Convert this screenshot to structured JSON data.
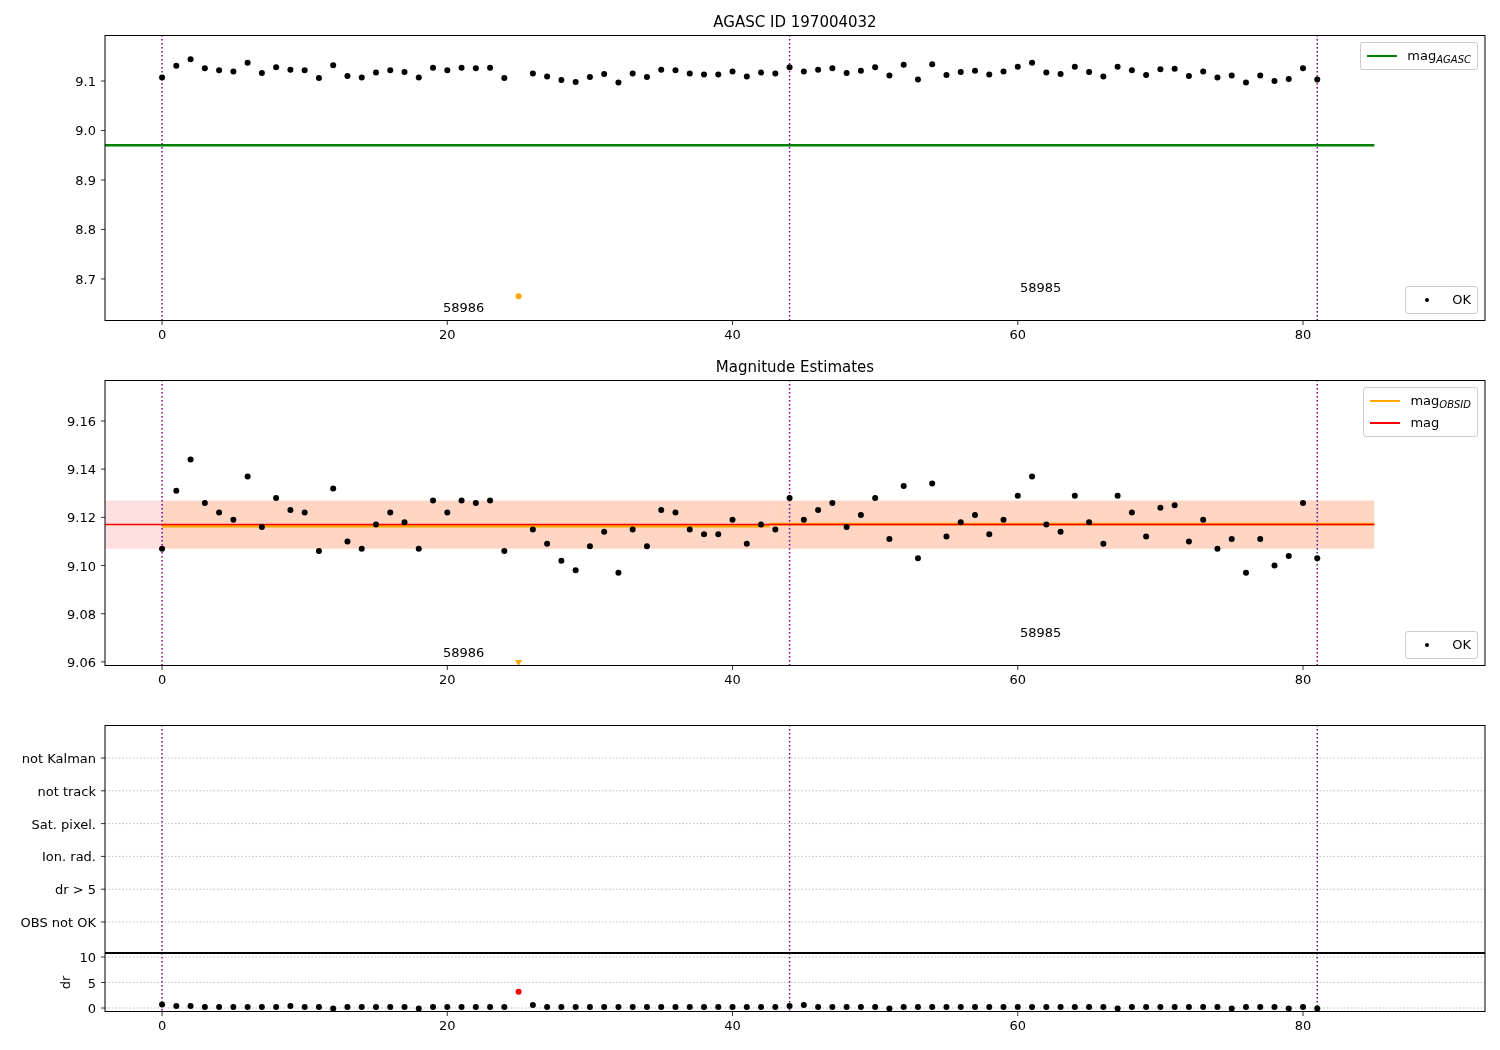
{
  "figure": {
    "panels": [
      {
        "kind": "chart",
        "chart_data": {
          "type": "scatter",
          "title": "AGASC ID 197004032",
          "legend": "right",
          "xlim": [
            -4,
            92.76
          ],
          "ylim": [
            8.615,
            9.193
          ],
          "xticks": [
            0,
            20,
            40,
            60,
            80
          ],
          "yticks": [
            {
              "value": 8.7,
              "label": "8.7"
            },
            {
              "value": 8.8,
              "label": "8.8"
            },
            {
              "value": 8.9,
              "label": "8.9"
            },
            {
              "value": 9.0,
              "label": "9.0"
            },
            {
              "value": 9.1,
              "label": "9.1"
            }
          ],
          "x": [
            0,
            1,
            2,
            3,
            4,
            5,
            6,
            7,
            8,
            9,
            10,
            11,
            12,
            13,
            14,
            15,
            16,
            17,
            18,
            19,
            20,
            21,
            22,
            23,
            24,
            25,
            26,
            27,
            28,
            29,
            30,
            31,
            32,
            33,
            34,
            35,
            36,
            37,
            38,
            39,
            40,
            41,
            42,
            43,
            44,
            45,
            46,
            47,
            48,
            49,
            50,
            51,
            52,
            53,
            54,
            55,
            56,
            57,
            58,
            59,
            60,
            61,
            62,
            63,
            64,
            65,
            66,
            67,
            68,
            69,
            70,
            71,
            72,
            73,
            74,
            75,
            76,
            77,
            78,
            79,
            80,
            81
          ],
          "series": [
            {
              "name": "mag$_{AGASC}$",
              "color": "#008000",
              "type": "line",
              "x": [
                -4,
                85
              ],
              "values": [
                8.97,
                8.97
              ]
            },
            {
              "name": "OK",
              "color": "#000000",
              "type": "scatter",
              "values": [
                9.107,
                9.131,
                9.144,
                9.126,
                9.122,
                9.119,
                9.137,
                9.116,
                9.128,
                9.123,
                9.122,
                9.106,
                9.132,
                9.11,
                9.107,
                9.117,
                9.122,
                9.118,
                9.107,
                9.127,
                9.122,
                9.127,
                9.126,
                9.127,
                9.106,
                null,
                9.115,
                9.109,
                9.102,
                9.098,
                9.108,
                9.114,
                9.097,
                9.115,
                9.108,
                9.123,
                9.122,
                9.115,
                9.113,
                9.113,
                9.119,
                9.109,
                9.117,
                9.115,
                9.128,
                9.119,
                9.123,
                9.126,
                9.116,
                9.121,
                9.128,
                9.111,
                9.133,
                9.103,
                9.134,
                9.112,
                9.118,
                9.121,
                9.113,
                9.119,
                9.129,
                9.137,
                9.117,
                9.114,
                9.129,
                9.118,
                9.109,
                9.129,
                9.122,
                9.112,
                9.124,
                9.125,
                9.11,
                9.119,
                9.107,
                9.111,
                9.097,
                9.111,
                9.1,
                9.104,
                9.126,
                9.103
              ]
            },
            {
              "color": "#ffa500",
              "type": "scatter",
              "values": [
                null,
                null,
                null,
                null,
                null,
                null,
                null,
                null,
                null,
                null,
                null,
                null,
                null,
                null,
                null,
                null,
                null,
                null,
                null,
                null,
                null,
                null,
                null,
                null,
                null,
                8.665,
                null,
                null,
                null,
                null,
                null,
                null,
                null,
                null,
                null,
                null,
                null,
                null,
                null,
                null,
                null,
                null,
                null,
                null,
                null,
                null,
                null,
                null,
                null,
                null,
                null,
                null,
                null,
                null,
                null,
                null,
                null,
                null,
                null,
                null,
                null,
                null,
                null,
                null,
                null,
                null,
                null,
                null,
                null,
                null,
                null,
                null,
                null,
                null,
                null,
                null,
                null,
                null,
                null,
                null,
                null,
                null
              ]
            }
          ],
          "ref_lines": [
            {
              "axis": "x",
              "value": 0,
              "color": "#800080"
            },
            {
              "axis": "x",
              "value": 44,
              "color": "#800080"
            },
            {
              "axis": "x",
              "value": 81,
              "color": "#800080"
            }
          ],
          "annotations": [
            "58986",
            "58985"
          ]
        }
      },
      {
        "kind": "chart",
        "chart_data": {
          "type": "scatter",
          "title": "Magnitude Estimates",
          "legend": "right",
          "xlim": [
            -4,
            92.76
          ],
          "ylim": [
            9.0583,
            9.177
          ],
          "xticks": [
            0,
            20,
            40,
            60,
            80
          ],
          "yticks": [
            {
              "value": 9.06,
              "label": "9.06"
            },
            {
              "value": 9.08,
              "label": "9.08"
            },
            {
              "value": 9.1,
              "label": "9.10"
            },
            {
              "value": 9.12,
              "label": "9.12"
            },
            {
              "value": 9.14,
              "label": "9.14"
            },
            {
              "value": 9.16,
              "label": "9.16"
            }
          ],
          "x": [
            0,
            1,
            2,
            3,
            4,
            5,
            6,
            7,
            8,
            9,
            10,
            11,
            12,
            13,
            14,
            15,
            16,
            17,
            18,
            19,
            20,
            21,
            22,
            23,
            24,
            25,
            26,
            27,
            28,
            29,
            30,
            31,
            32,
            33,
            34,
            35,
            36,
            37,
            38,
            39,
            40,
            41,
            42,
            43,
            44,
            45,
            46,
            47,
            48,
            49,
            50,
            51,
            52,
            53,
            54,
            55,
            56,
            57,
            58,
            59,
            60,
            61,
            62,
            63,
            64,
            65,
            66,
            67,
            68,
            69,
            70,
            71,
            72,
            73,
            74,
            75,
            76,
            77,
            78,
            79,
            80,
            81
          ],
          "series": [
            {
              "name": "mag$_{OBSID}$",
              "color": "#ffa500",
              "type": "line",
              "x": [
                0,
                42.6,
                null,
                42.6,
                85
              ],
              "values": [
                9.1163,
                9.1163,
                null,
                9.1172,
                9.1172
              ],
              "lower": [
                9.107,
                9.107,
                null,
                9.107,
                9.107
              ],
              "upper": [
                9.127,
                9.127,
                null,
                9.127,
                9.127
              ]
            },
            {
              "name": "mag",
              "color": "#ff0000",
              "type": "line",
              "x": [
                -4,
                85
              ],
              "values": [
                9.117,
                9.117
              ],
              "lower": [
                9.107,
                9.107
              ],
              "upper": [
                9.127,
                9.127
              ]
            },
            {
              "name": "OK",
              "color": "#000000",
              "values": [
                9.107,
                9.131,
                9.144,
                9.126,
                9.122,
                9.119,
                9.137,
                9.116,
                9.128,
                9.123,
                9.122,
                9.106,
                9.132,
                9.11,
                9.107,
                9.117,
                9.122,
                9.118,
                9.107,
                9.127,
                9.122,
                9.127,
                9.126,
                9.127,
                9.106,
                null,
                9.115,
                9.109,
                9.102,
                9.098,
                9.108,
                9.114,
                9.097,
                9.115,
                9.108,
                9.123,
                9.122,
                9.115,
                9.113,
                9.113,
                9.119,
                9.109,
                9.117,
                9.115,
                9.128,
                9.119,
                9.123,
                9.126,
                9.116,
                9.121,
                9.128,
                9.111,
                9.133,
                9.103,
                9.134,
                9.112,
                9.118,
                9.121,
                9.113,
                9.119,
                9.129,
                9.137,
                9.117,
                9.114,
                9.129,
                9.118,
                9.109,
                9.129,
                9.122,
                9.112,
                9.124,
                9.125,
                9.11,
                9.119,
                9.107,
                9.111,
                9.097,
                9.111,
                9.1,
                9.104,
                9.126,
                9.103
              ]
            },
            {
              "color": "#ffa500",
              "marker": "v",
              "values": [
                null,
                null,
                null,
                null,
                null,
                null,
                null,
                null,
                null,
                null,
                null,
                null,
                null,
                null,
                null,
                null,
                null,
                null,
                null,
                null,
                null,
                null,
                null,
                null,
                null,
                9.0595,
                null,
                null,
                null,
                null,
                null,
                null,
                null,
                null,
                null,
                null,
                null,
                null,
                null,
                null,
                null,
                null,
                null,
                null,
                null,
                null,
                null,
                null,
                null,
                null,
                null,
                null,
                null,
                null,
                null,
                null,
                null,
                null,
                null,
                null,
                null,
                null,
                null,
                null,
                null,
                null,
                null,
                null,
                null,
                null,
                null,
                null,
                null,
                null,
                null,
                null,
                null,
                null,
                null,
                null,
                null,
                null
              ]
            }
          ],
          "ref_lines": [
            {
              "axis": "x",
              "value": 0,
              "color": "#800080"
            },
            {
              "axis": "x",
              "value": 44,
              "color": "#800080"
            },
            {
              "axis": "x",
              "value": 81,
              "color": "#800080"
            }
          ],
          "annotations": [
            "58986",
            "58985"
          ]
        }
      },
      {
        "kind": "flags",
        "labels": [
          "not Kalman",
          "not track",
          "Sat. pixel.",
          "Ion. rad.",
          "dr > 5",
          "OBS not OK"
        ]
      },
      {
        "kind": "chart",
        "chart_data": {
          "type": "scatter",
          "ylabel": "dr",
          "grid": true,
          "xlim": [
            -4,
            92.76
          ],
          "ylim": [
            -0.78,
            10.78
          ],
          "xticks": [
            0,
            20,
            40,
            60,
            80
          ],
          "yticks": [
            0,
            5,
            10
          ],
          "x": [
            0,
            1,
            2,
            3,
            4,
            5,
            6,
            7,
            8,
            9,
            10,
            11,
            12,
            13,
            14,
            15,
            16,
            17,
            18,
            19,
            20,
            21,
            22,
            23,
            24,
            25,
            26,
            27,
            28,
            29,
            30,
            31,
            32,
            33,
            34,
            35,
            36,
            37,
            38,
            39,
            40,
            41,
            42,
            43,
            44,
            45,
            46,
            47,
            48,
            49,
            50,
            51,
            52,
            53,
            54,
            55,
            56,
            57,
            58,
            59,
            60,
            61,
            62,
            63,
            64,
            65,
            66,
            67,
            68,
            69,
            70,
            71,
            72,
            73,
            74,
            75,
            76,
            77,
            78,
            79,
            80,
            81
          ],
          "series": [
            {
              "color": "#000000",
              "values": [
                0.7,
                0.4,
                0.4,
                0.2,
                0.2,
                0.2,
                0.2,
                0.2,
                0.2,
                0.4,
                0.2,
                0.2,
                -0.1,
                0.2,
                0.2,
                0.2,
                0.2,
                0.2,
                -0.1,
                0.2,
                0.2,
                0.2,
                0.2,
                0.2,
                0.2,
                null,
                0.6,
                0.2,
                0.2,
                0.2,
                0.2,
                0.2,
                0.2,
                0.2,
                0.2,
                0.2,
                0.2,
                0.2,
                0.2,
                0.2,
                0.2,
                0.2,
                0.2,
                0.2,
                0.4,
                0.6,
                0.2,
                0.2,
                0.2,
                0.2,
                0.2,
                -0.1,
                0.2,
                0.2,
                0.2,
                0.2,
                0.2,
                0.2,
                0.2,
                0.2,
                0.2,
                0.2,
                0.2,
                0.2,
                0.2,
                0.2,
                0.2,
                -0.1,
                0.2,
                0.2,
                0.2,
                0.2,
                0.2,
                0.2,
                0.2,
                -0.1,
                0.2,
                0.2,
                0.2,
                -0.1,
                0.2,
                -0.1
              ]
            },
            {
              "color": "#ff0000",
              "values": [
                null,
                null,
                null,
                null,
                null,
                null,
                null,
                null,
                null,
                null,
                null,
                null,
                null,
                null,
                null,
                null,
                null,
                null,
                null,
                null,
                null,
                null,
                null,
                null,
                null,
                3.2,
                null,
                null,
                null,
                null,
                null,
                null,
                null,
                null,
                null,
                null,
                null,
                null,
                null,
                null,
                null,
                null,
                null,
                null,
                null,
                null,
                null,
                null,
                null,
                null,
                null,
                null,
                null,
                null,
                null,
                null,
                null,
                null,
                null,
                null,
                null,
                null,
                null,
                null,
                null,
                null,
                null,
                null,
                null,
                null,
                null,
                null,
                null,
                null,
                null,
                null,
                null,
                null,
                null,
                null,
                null,
                null
              ]
            }
          ],
          "ref_lines": [
            {
              "axis": "x",
              "value": 0,
              "color": "#800080"
            },
            {
              "axis": "x",
              "value": 44,
              "color": "#800080"
            },
            {
              "axis": "x",
              "value": 81,
              "color": "#800080"
            }
          ]
        }
      }
    ]
  }
}
